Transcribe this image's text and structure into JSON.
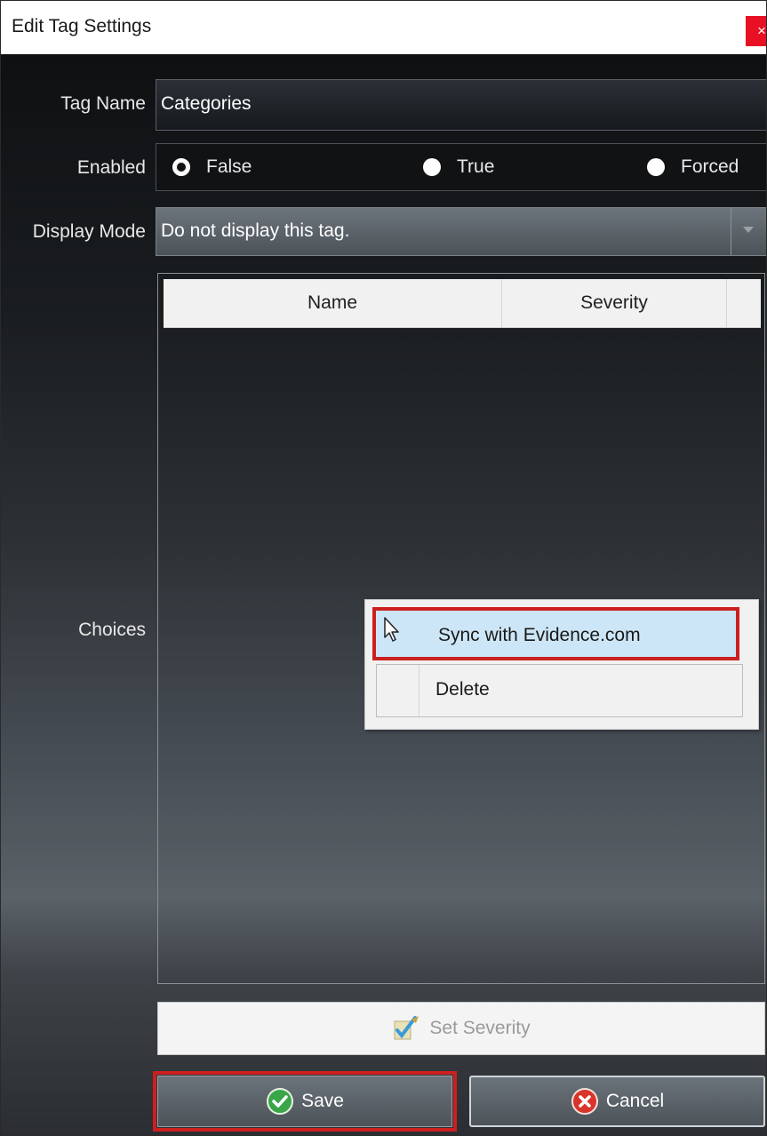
{
  "window": {
    "title": "Edit Tag Settings",
    "close_glyph": "×"
  },
  "form": {
    "tag_name_label": "Tag Name",
    "tag_name_value": "Categories",
    "enabled_label": "Enabled",
    "enabled_options": [
      {
        "label": "False",
        "selected": true
      },
      {
        "label": "True",
        "selected": false
      },
      {
        "label": "Forced",
        "selected": false
      }
    ],
    "display_mode_label": "Display Mode",
    "display_mode_value": "Do not display this tag.",
    "choices_label": "Choices",
    "choices_columns": [
      "Name",
      "Severity"
    ]
  },
  "context_menu": {
    "items": [
      {
        "label": "Sync with Evidence.com",
        "highlighted": true
      },
      {
        "label": "Delete",
        "highlighted": false
      }
    ]
  },
  "buttons": {
    "set_severity": "Set Severity",
    "save": "Save",
    "cancel": "Cancel"
  },
  "colors": {
    "highlight_outline": "#cc1f1f",
    "menu_hover": "#cde6f7",
    "save_icon": "#3aa64a",
    "cancel_icon": "#d9342b"
  },
  "icons": {
    "save": "checkmark-circle-icon",
    "cancel": "x-circle-icon",
    "set_severity": "edit-pencil-icon",
    "cursor": "mouse-pointer-icon",
    "close": "close-icon",
    "dropdown": "chevron-down-icon"
  }
}
